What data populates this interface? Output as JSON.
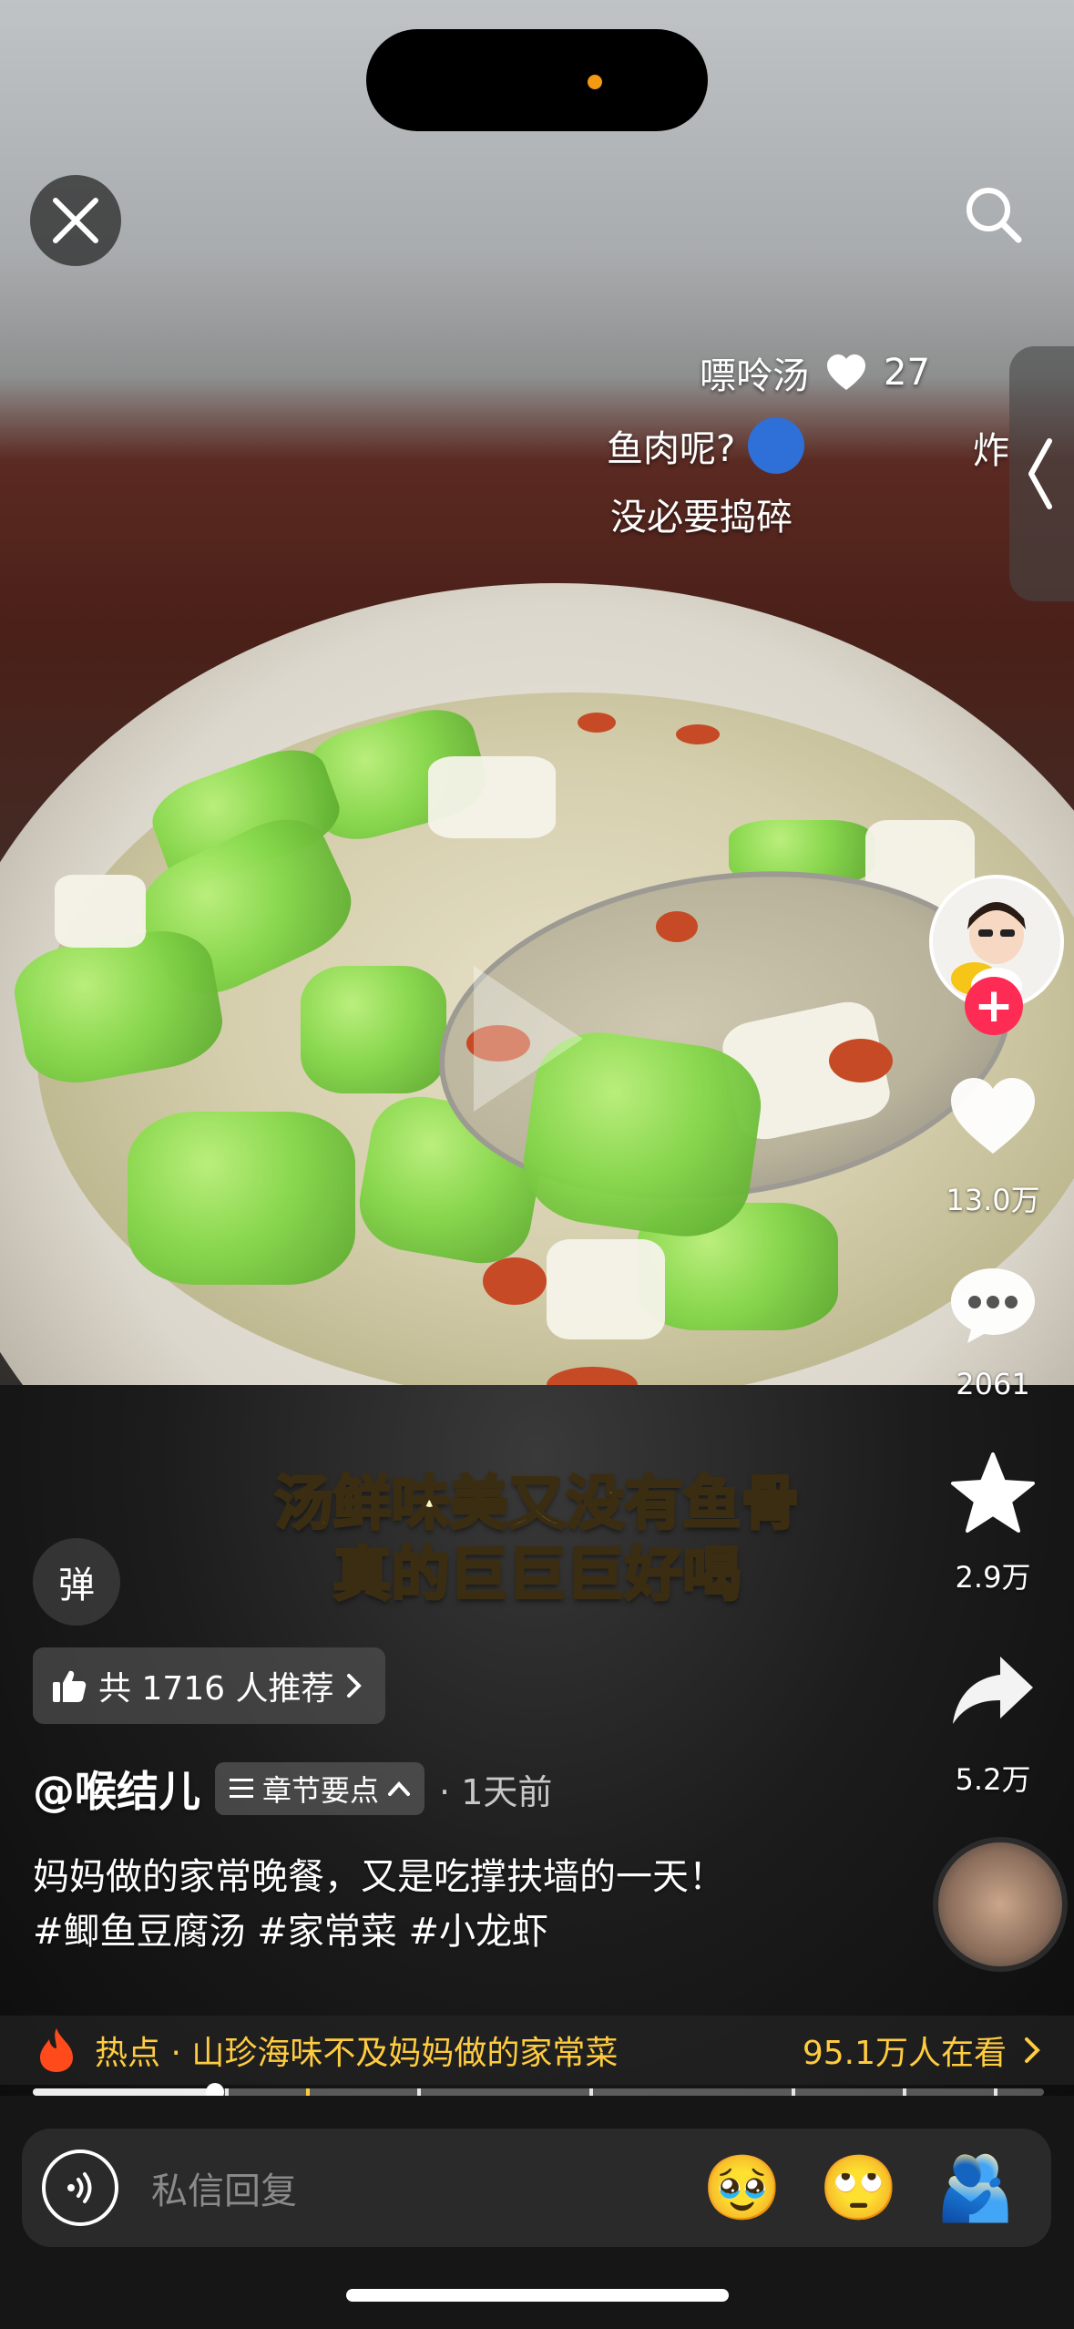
{
  "danmaku": [
    {
      "text": "嘌呤汤",
      "likes": "27"
    },
    {
      "text": "鱼肉呢?"
    },
    {
      "text": "炸"
    },
    {
      "text": "没必要捣碎"
    }
  ],
  "subtitle": {
    "line1": "汤鲜味美又没有鱼骨",
    "line2": "真的巨巨巨好喝"
  },
  "rail": {
    "likes": "13.0万",
    "comments": "2061",
    "favorites": "2.9万",
    "shares": "5.2万"
  },
  "danmaku_toggle": "弹",
  "recommend": {
    "label": "共 1716 人推荐"
  },
  "author": {
    "name": "@喉结儿",
    "chapter_label": "章节要点",
    "separator": "·",
    "time": "1天前"
  },
  "caption": {
    "line1": "妈妈做的家常晚餐，又是吃撑扶墙的一天！",
    "hashtags": [
      "#鲫鱼豆腐汤",
      "#家常菜",
      "#小龙虾"
    ]
  },
  "hot": {
    "label": "热点 · 山珍海味不及妈妈做的家常菜",
    "viewers": "95.1万人在看"
  },
  "progress": {
    "fraction": 0.18,
    "chapter_ticks": [
      0.19,
      0.27,
      0.38,
      0.55,
      0.75,
      0.86,
      0.95
    ]
  },
  "reply": {
    "placeholder": "私信回复"
  },
  "reactions": [
    "🥹",
    "🙄",
    "🫂"
  ],
  "colors": {
    "accent": "#fe2c55",
    "hot": "#ffcc40",
    "island_dot": "#f39a12"
  }
}
